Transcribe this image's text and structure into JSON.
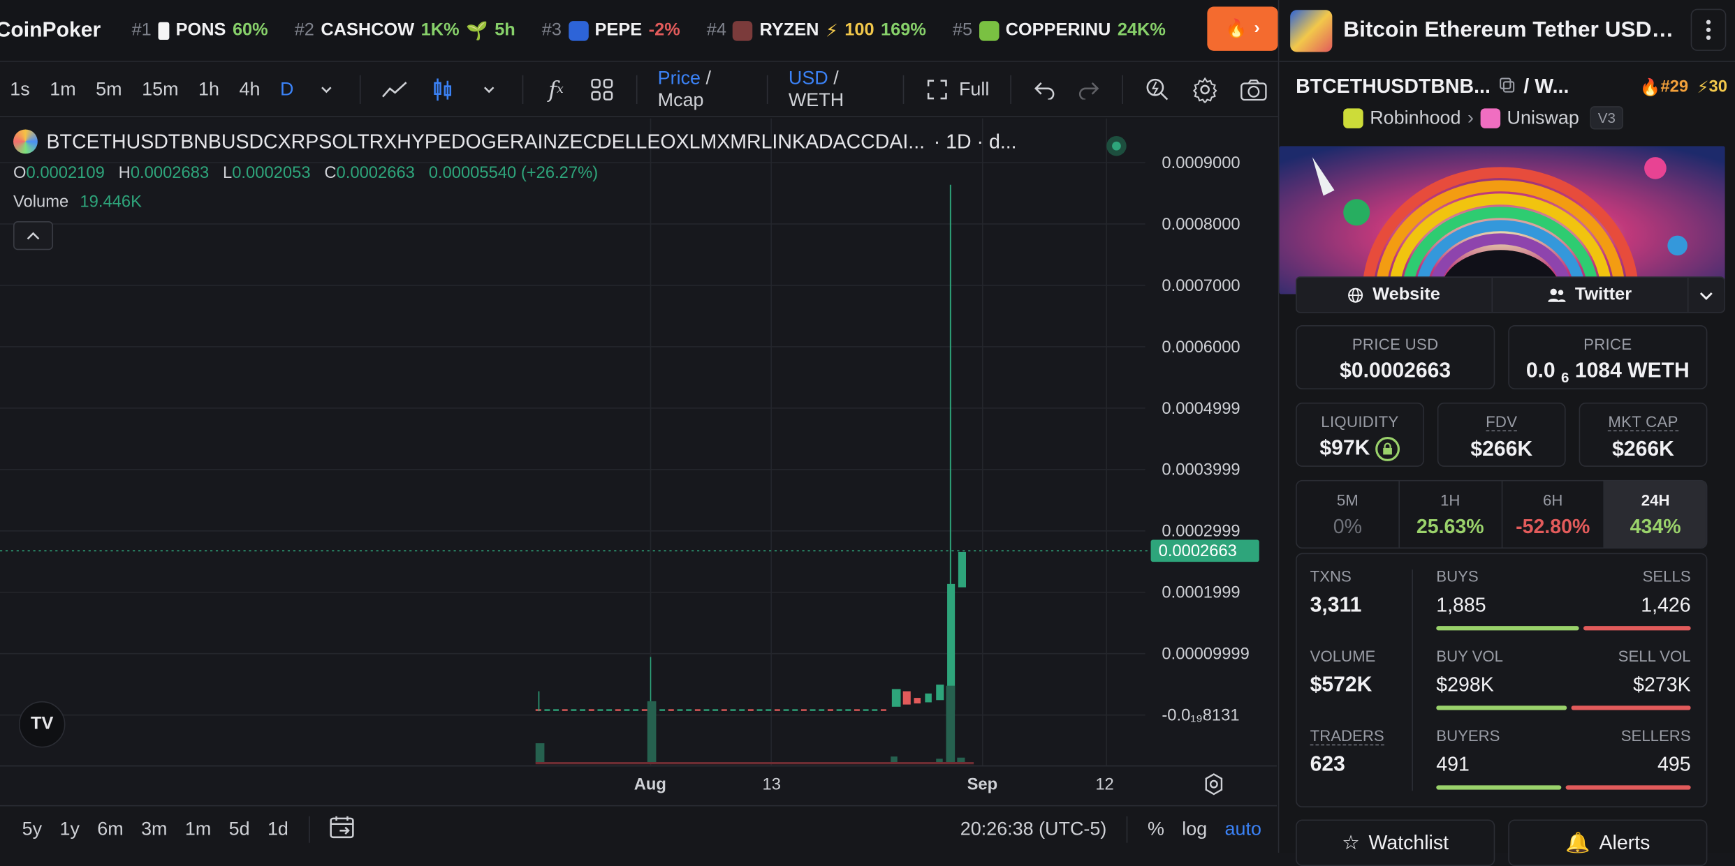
{
  "ticker": {
    "brand": "CoinPoker",
    "items": [
      {
        "rank": "#1",
        "symbol": "PONS",
        "change": "60%",
        "change_class": "pos",
        "extra": ""
      },
      {
        "rank": "#2",
        "symbol": "CASHCOW",
        "change": "1K%",
        "change_class": "pos",
        "extra": "5h"
      },
      {
        "rank": "#3",
        "symbol": "PEPE",
        "change": "-2%",
        "change_class": "neg",
        "extra": ""
      },
      {
        "rank": "#4",
        "symbol": "RYZEN",
        "change": "169%",
        "change_class": "pos",
        "extra": "100"
      },
      {
        "rank": "#5",
        "symbol": "COPPERINU",
        "change": "24K%",
        "change_class": "pos",
        "extra": ""
      }
    ]
  },
  "toolbar": {
    "timeframes": [
      "1s",
      "1m",
      "5m",
      "15m",
      "1h",
      "4h",
      "D"
    ],
    "active_tf": "D",
    "price_label": "Price",
    "mcap_label": "Mcap",
    "usd_label": "USD",
    "weth_label": "WETH",
    "full_label": "Full"
  },
  "chart": {
    "title": "BTCETHUSDTBNBUSDCXRPSOLTRXHYPEDOGERAINZECDELLEOXLMXMRLINKADACCDAI...",
    "interval": "· 1D · d...",
    "ohlc": {
      "o_label": "O",
      "o": "0.0002109",
      "h_label": "H",
      "h": "0.0002683",
      "l_label": "L",
      "l": "0.0002053",
      "c_label": "C",
      "c": "0.0002663",
      "chg": "0.00005540 (+26.27%)"
    },
    "volume_label": "Volume",
    "volume_value": "19.446K",
    "price_axis": [
      "0.0009000",
      "0.0008000",
      "0.0007000",
      "0.0006000",
      "0.0004999",
      "0.0003999",
      "0.0002999",
      "0.0001999",
      "0.00009999",
      "-0.0₁₉8131"
    ],
    "current_price": "0.0002663",
    "time_labels": [
      "Aug",
      "13",
      "Sep",
      "12"
    ],
    "tv_logo": "TV"
  },
  "bottombar": {
    "ranges": [
      "5y",
      "1y",
      "6m",
      "3m",
      "1m",
      "5d",
      "1d"
    ],
    "clock": "20:26:38 (UTC-5)",
    "percent": "%",
    "log": "log",
    "auto": "auto"
  },
  "panel": {
    "title": "Bitcoin Ethereum Tether USDt...",
    "pair": "BTCETHUSDTBNB...",
    "quote": "/ W...",
    "rank": "#29",
    "boost": "30",
    "chain": "Robinhood",
    "dex": "Uniswap",
    "version": "V3",
    "website": "Website",
    "twitter": "Twitter",
    "price_usd_label": "PRICE USD",
    "price_usd": "$0.0002663",
    "price_label": "PRICE",
    "price_weth_a": "0.0",
    "price_weth_sub": "6",
    "price_weth_b": "1084 WETH",
    "liquidity_label": "LIQUIDITY",
    "liquidity": "$97K",
    "fdv_label": "FDV",
    "fdv": "$266K",
    "mcap_label": "MKT CAP",
    "mcap": "$266K",
    "tabs": [
      {
        "label": "5M",
        "value": "0%",
        "cls": "muted"
      },
      {
        "label": "1H",
        "value": "25.63%",
        "cls": "up"
      },
      {
        "label": "6H",
        "value": "-52.80%",
        "cls": "down"
      },
      {
        "label": "24H",
        "value": "434%",
        "cls": "up"
      }
    ],
    "txns_label": "TXNS",
    "txns": "3,311",
    "volume_label": "VOLUME",
    "volume": "$572K",
    "traders_label": "TRADERS",
    "traders": "623",
    "buys_label": "BUYS",
    "buys": "1,885",
    "sells_label": "SELLS",
    "sells": "1,426",
    "buyvol_label": "BUY VOL",
    "buyvol": "$298K",
    "sellvol_label": "SELL VOL",
    "sellvol": "$273K",
    "buyers_label": "BUYERS",
    "buyers": "491",
    "sellers_label": "SELLERS",
    "sellers": "495",
    "watchlist": "Watchlist",
    "alerts": "Alerts"
  }
}
